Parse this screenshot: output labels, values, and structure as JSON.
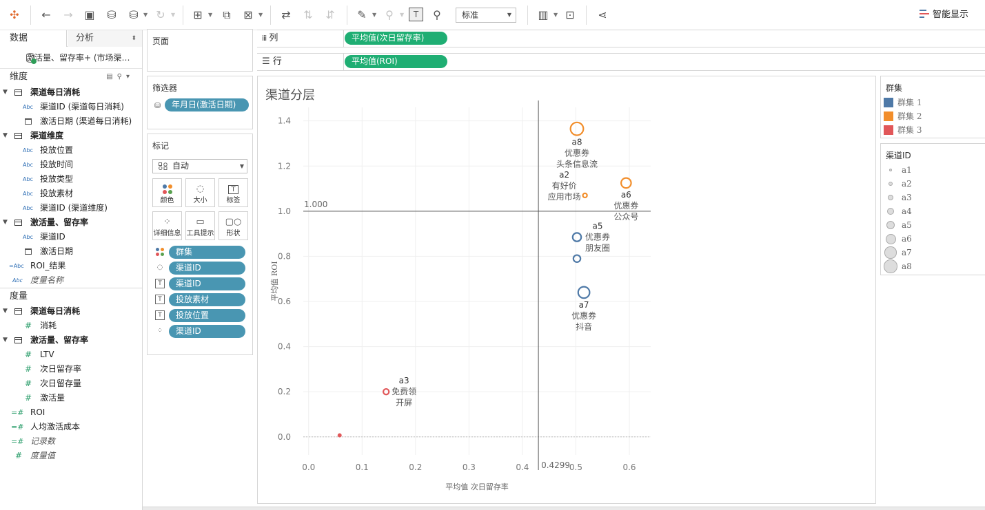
{
  "toolbar": {
    "fit_mode": "标准",
    "show_me": "智能显示"
  },
  "left_pane": {
    "tabs": [
      "数据",
      "分析"
    ],
    "source": "激活量、留存率+ (市场渠…",
    "dimensions_title": "维度",
    "dimensions": [
      {
        "kind": "group",
        "label": "渠道每日消耗"
      },
      {
        "kind": "abc",
        "label": "渠道ID (渠道每日消耗)"
      },
      {
        "kind": "date",
        "label": "激活日期 (渠道每日消耗)"
      },
      {
        "kind": "group",
        "label": "渠道维度"
      },
      {
        "kind": "abc",
        "label": "投放位置"
      },
      {
        "kind": "abc",
        "label": "投放时间"
      },
      {
        "kind": "abc",
        "label": "投放类型"
      },
      {
        "kind": "abc",
        "label": "投放素材"
      },
      {
        "kind": "abc",
        "label": "渠道ID (渠道维度)"
      },
      {
        "kind": "group",
        "label": "激活量、留存率"
      },
      {
        "kind": "abc",
        "label": "渠道ID"
      },
      {
        "kind": "date",
        "label": "激活日期"
      },
      {
        "kind": "calc-abc",
        "label": "ROI_结果"
      },
      {
        "kind": "abc-italic",
        "label": "度量名称"
      }
    ],
    "measures_title": "度量",
    "measures": [
      {
        "kind": "group",
        "label": "渠道每日消耗"
      },
      {
        "kind": "num",
        "label": "消耗"
      },
      {
        "kind": "group",
        "label": "激活量、留存率"
      },
      {
        "kind": "num",
        "label": "LTV"
      },
      {
        "kind": "num",
        "label": "次日留存率"
      },
      {
        "kind": "num",
        "label": "次日留存量"
      },
      {
        "kind": "num",
        "label": "激活量"
      },
      {
        "kind": "calc-num",
        "label": "ROI"
      },
      {
        "kind": "calc-num",
        "label": "人均激活成本"
      },
      {
        "kind": "calc-num-italic",
        "label": "记录数"
      },
      {
        "kind": "num-italic",
        "label": "度量值"
      }
    ]
  },
  "pages_pane": {
    "title": "页面"
  },
  "filters_pane": {
    "title": "筛选器",
    "pill": "年月日(激活日期)"
  },
  "marks_pane": {
    "title": "标记",
    "mark_type": "自动",
    "buttons": [
      "颜色",
      "大小",
      "标签",
      "详细信息",
      "工具提示",
      "形状"
    ],
    "fields": [
      {
        "icon": "color",
        "label": "群集"
      },
      {
        "icon": "size",
        "label": "渠道ID"
      },
      {
        "icon": "label",
        "label": "渠道ID"
      },
      {
        "icon": "label",
        "label": "投放素材"
      },
      {
        "icon": "label",
        "label": "投放位置"
      },
      {
        "icon": "detail",
        "label": "渠道ID"
      }
    ]
  },
  "shelves": {
    "columns_label": "列",
    "columns_pill": "平均值(次日留存率)",
    "rows_label": "行",
    "rows_pill": "平均值(ROI)"
  },
  "viz": {
    "title": "渠道分层"
  },
  "chart_data": {
    "type": "scatter",
    "title": "渠道分层",
    "xlabel": "平均值 次日留存率",
    "ylabel": "平均值 ROI",
    "xlim": [
      -0.01,
      0.64
    ],
    "ylim": [
      -0.08,
      1.46
    ],
    "x_ticks": [
      0.0,
      0.1,
      0.2,
      0.3,
      0.4,
      0.5,
      0.6
    ],
    "x_tick_labels": [
      "0.0",
      "0.1",
      "0.2",
      "0.3",
      "0.4",
      "0.5",
      "0.6"
    ],
    "y_ticks": [
      0.0,
      0.2,
      0.4,
      0.6,
      0.8,
      1.0,
      1.2,
      1.4
    ],
    "y_tick_labels": [
      "0.0",
      "0.2",
      "0.4",
      "0.6",
      "0.8",
      "1.0",
      "1.2",
      "1.4"
    ],
    "reference_lines": [
      {
        "axis": "y",
        "value": 1.0,
        "label": "1.000"
      },
      {
        "axis": "x",
        "value": 0.4299,
        "label": "0.4299"
      }
    ],
    "cluster_colors": {
      "群集 1": "#4e79a7",
      "群集 2": "#f28e2b",
      "群集 3": "#e15759"
    },
    "points": [
      {
        "id": "a1",
        "x": 0.058,
        "y": 0.007,
        "cluster": "群集 3",
        "size": 1,
        "labels": []
      },
      {
        "id": "a2",
        "x": 0.517,
        "y": 1.07,
        "cluster": "群集 2",
        "size": 2,
        "labels": [
          "a2",
          "有好价",
          "应用市场"
        ]
      },
      {
        "id": "a3",
        "x": 0.145,
        "y": 0.2,
        "cluster": "群集 3",
        "size": 3,
        "labels": [
          "a3",
          "免费领",
          "开屏"
        ]
      },
      {
        "id": "a4",
        "x": 0.502,
        "y": 0.79,
        "cluster": "群集 1",
        "size": 4,
        "labels": []
      },
      {
        "id": "a5",
        "x": 0.502,
        "y": 0.885,
        "cluster": "群集 1",
        "size": 5,
        "labels": [
          "a5",
          "优惠券",
          "朋友圈"
        ]
      },
      {
        "id": "a6",
        "x": 0.594,
        "y": 1.125,
        "cluster": "群集 2",
        "size": 6,
        "labels": [
          "a6",
          "优惠券",
          "公众号"
        ]
      },
      {
        "id": "a7",
        "x": 0.515,
        "y": 0.64,
        "cluster": "群集 1",
        "size": 7,
        "labels": [
          "a7",
          "优惠券",
          "抖音"
        ]
      },
      {
        "id": "a8",
        "x": 0.502,
        "y": 1.365,
        "cluster": "群集 2",
        "size": 8,
        "labels": [
          "a8",
          "优惠券",
          "头条信息流"
        ]
      }
    ]
  },
  "legend_cluster": {
    "title": "群集",
    "items": [
      {
        "label": "群集 1",
        "color": "#4e79a7"
      },
      {
        "label": "群集 2",
        "color": "#f28e2b"
      },
      {
        "label": "群集 3",
        "color": "#e15759"
      }
    ]
  },
  "legend_channel": {
    "title": "渠道ID",
    "items": [
      "a1",
      "a2",
      "a3",
      "a4",
      "a5",
      "a6",
      "a7",
      "a8"
    ]
  }
}
